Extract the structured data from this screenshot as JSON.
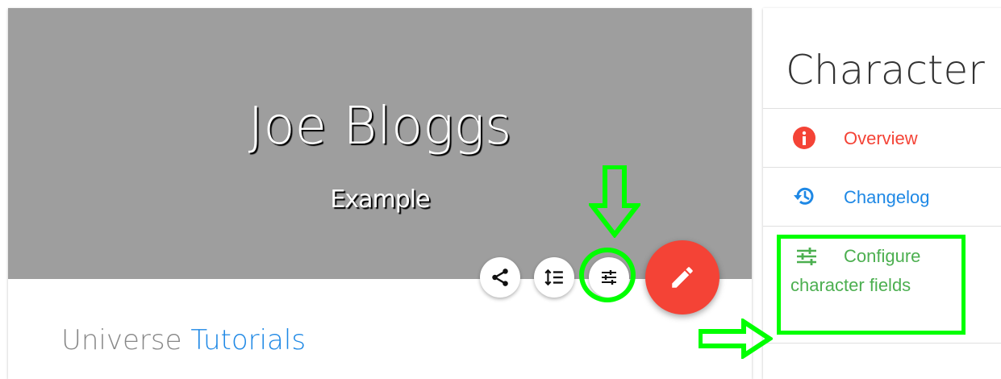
{
  "hero": {
    "title": "Joe Bloggs",
    "subtitle": "Example"
  },
  "universe": {
    "label": "Universe",
    "link": "Tutorials"
  },
  "side": {
    "title": "Character",
    "items": [
      {
        "label": "Overview",
        "icon": "info-circle-icon",
        "color": "#f44336"
      },
      {
        "label": "Changelog",
        "icon": "history-icon",
        "color": "#1e88e5"
      },
      {
        "label": "Configure character fields",
        "icon": "tune-icon",
        "color": "#4caf50"
      }
    ]
  },
  "colors": {
    "hero_bg": "#9e9e9e",
    "fab_red": "#f44336",
    "link_blue": "#1e88e5",
    "annotation_green": "#00ff00"
  }
}
